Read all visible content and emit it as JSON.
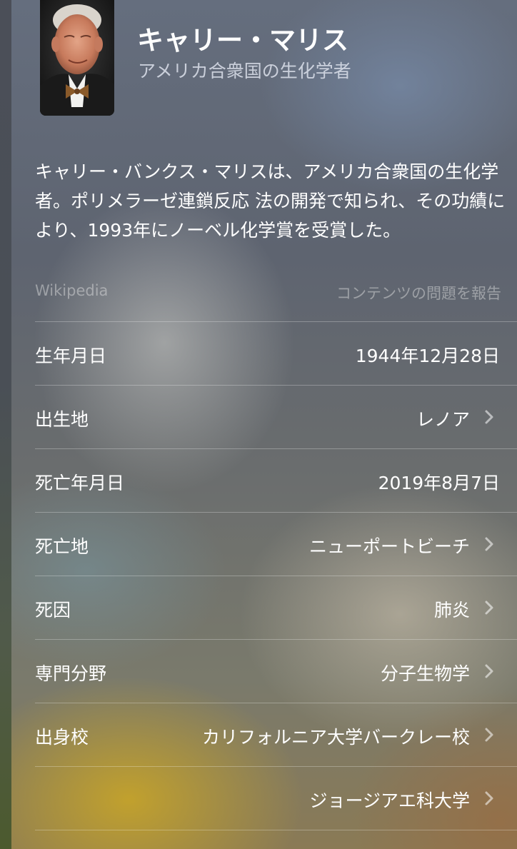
{
  "header": {
    "title": "キャリー・マリス",
    "subtitle": "アメリカ合衆国の生化学者"
  },
  "summary": {
    "text": "キャリー・バンクス・マリスは、アメリカ合衆国の生化学者。ポリメラーゼ連鎖反応 法の開発で知られ、その功績により、1993年にノーベル化学賞を受賞した。",
    "source": "Wikipedia",
    "report_link": "コンテンツの問題を報告"
  },
  "facts": [
    {
      "label": "生年月日",
      "value": "1944年12月28日",
      "link": false
    },
    {
      "label": "出生地",
      "value": "レノア",
      "link": true
    },
    {
      "label": "死亡年月日",
      "value": "2019年8月7日",
      "link": false
    },
    {
      "label": "死亡地",
      "value": "ニューポートビーチ",
      "link": true
    },
    {
      "label": "死因",
      "value": "肺炎",
      "link": true
    },
    {
      "label": "専門分野",
      "value": "分子生物学",
      "link": true
    },
    {
      "label": "出身校",
      "value": "カリフォルニア大学バークレー校",
      "link": true
    },
    {
      "label": "",
      "value": "ジョージアエ科大学",
      "link": true
    }
  ],
  "icons": {
    "chevron": "chevron-right-icon",
    "photo": "portrait-photo"
  }
}
